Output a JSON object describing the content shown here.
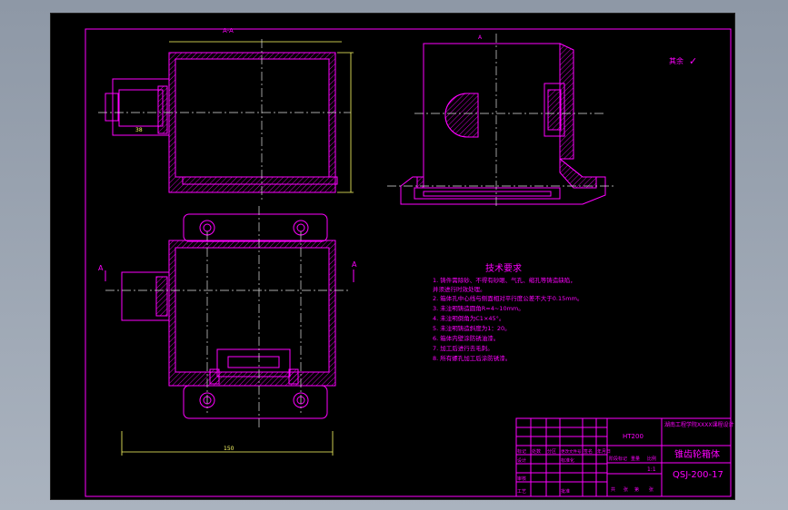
{
  "colors": {
    "background": "#000000",
    "outline": "#ff00ff",
    "centerline": "#e0e0e0",
    "dimension": "#ffff66",
    "window_backdrop": "#9aa3af"
  },
  "view_labels": {
    "section_top": "A-A",
    "section_left_marker": "A",
    "section_right_marker": "A"
  },
  "surface_finish": {
    "label": "其余",
    "symbol": "✓"
  },
  "tech_requirements": {
    "title": "技术要求",
    "items": [
      "1. 铸件需除砂、不得有砂眼、气孔、缩孔等铸造缺陷，",
      "   并须进行时效处理。",
      "2. 箱体孔中心线与侧面相对平行度公差不大于0.15mm。",
      "3. 未注明铸造圆角R=4~10mm。",
      "4. 未注明倒角为C1×45°。",
      "5. 未注明铸造斜度为1：20。",
      "6. 箱体内壁涂防锈油漆。",
      "7. 加工后进行去毛刺。",
      "8. 所有螺孔加工后涂防锈漆。"
    ]
  },
  "title_block": {
    "material": "HT200",
    "school": "湖南工程学院XXXX课程设计",
    "part_name": "锥齿轮箱体",
    "drawing_number": "QSJ-200-17",
    "scale": "1:1",
    "header_cells": [
      "标记",
      "处数",
      "分区",
      "更改文件号",
      "签名",
      "年月日"
    ],
    "row2": [
      "设计",
      "",
      "",
      "标准化",
      "",
      ""
    ],
    "row3": [
      "审核",
      "",
      "",
      "",
      "",
      ""
    ],
    "row4": [
      "工艺",
      "",
      "",
      "批准",
      "",
      ""
    ],
    "stage_labels": [
      "阶段标记",
      "重量",
      "比例"
    ],
    "sheet_info": [
      "共",
      "张",
      "第",
      "张"
    ]
  }
}
